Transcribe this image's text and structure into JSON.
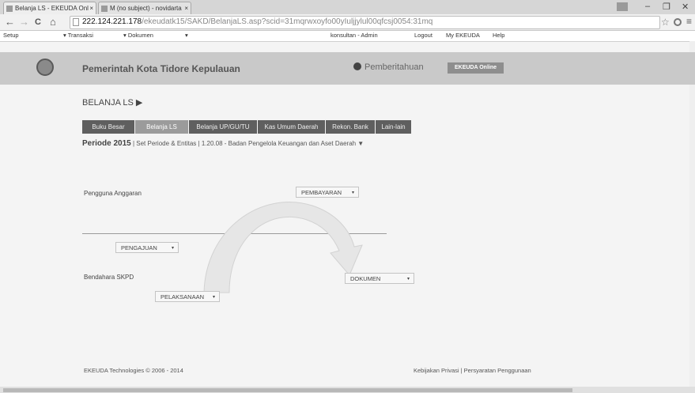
{
  "browser": {
    "tabs": [
      {
        "label": "Belanja LS - EKEUDA Onl",
        "close": "×"
      },
      {
        "label": "M (no subject) - novidarta",
        "close": "×"
      }
    ],
    "window_controls": {
      "minimize": "–",
      "maximize": "❐",
      "close": "✕"
    },
    "url_host": "222.124.221.178",
    "url_path": "/ekeudatk15/SAKD/BelanjaLS.asp?scid=31mqrwxoyfo00yIuljjylul00qfcsj0054:31mq",
    "nav": {
      "back": "←",
      "forward": "→",
      "reload": "C",
      "home": "⌂"
    }
  },
  "menubar": {
    "setup": "Setup",
    "transaksi": "▾ Transaksi",
    "dokumen": "▾ Dokumen",
    "extra": "▾",
    "user": "konsultan - Admin",
    "logout": "Logout",
    "my": "My EKEUDA",
    "help": "Help"
  },
  "header": {
    "org": "Pemerintah Kota Tidore Kepulauan",
    "notif": "Pemberitahuan",
    "badge": "EKEUDA Online"
  },
  "page": {
    "title": "BELANJA LS ▶",
    "tabs": [
      "Buku Besar",
      "Belanja LS",
      "Belanja UP/GU/TU",
      "Kas Umum Daerah",
      "Rekon. Bank",
      "Lain-lain"
    ],
    "periode_label": "Periode 2015",
    "periode_rest": "| Set Periode & Entitas | 1.20.08 - Badan Pengelola Keuangan dan Aset Daerah ▼"
  },
  "flow": {
    "pengguna": "Pengguna Anggaran",
    "bendahara": "Bendahara SKPD",
    "pembayaran": "PEMBAYARAN",
    "pengajuan": "PENGAJUAN",
    "pelaksanaan": "PELAKSANAAN",
    "dokumen": "DOKUMEN",
    "caret": "▾"
  },
  "footer": {
    "copy": "EKEUDA Technologies © 2006 - 2014",
    "links": "Kebijakan Privasi | Persyaratan Penggunaan"
  }
}
